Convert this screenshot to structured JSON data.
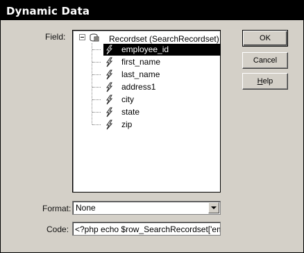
{
  "window": {
    "title": "Dynamic Data"
  },
  "labels": {
    "field": "Field:",
    "format": "Format:",
    "code": "Code:"
  },
  "tree": {
    "root_label": "Recordset (SearchRecordset)",
    "root_icon": "recordset-icon",
    "item_icon": "lightning-bolt-icon",
    "items": [
      {
        "label": "employee_id",
        "selected": true
      },
      {
        "label": "first_name"
      },
      {
        "label": "last_name"
      },
      {
        "label": "address1"
      },
      {
        "label": "city"
      },
      {
        "label": "state"
      },
      {
        "label": "zip"
      }
    ]
  },
  "buttons": {
    "ok": "OK",
    "cancel": "Cancel",
    "help_underlined": "H",
    "help_rest": "elp"
  },
  "format": {
    "value": "None"
  },
  "code": {
    "value": "<?php echo $row_SearchRecordset['em"
  }
}
